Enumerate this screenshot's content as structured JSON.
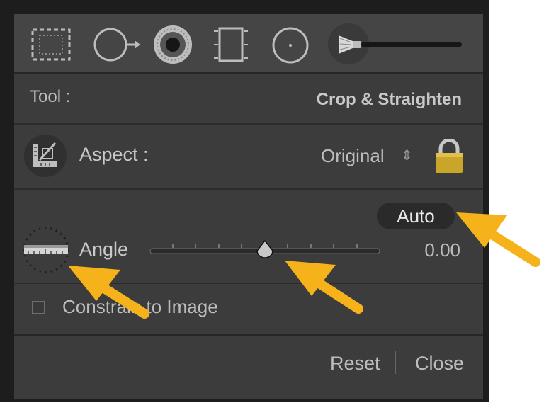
{
  "tools": [
    {
      "name": "Crop Overlay"
    },
    {
      "name": "Spot Removal"
    },
    {
      "name": "Red Eye Correction"
    },
    {
      "name": "Graduated Filter"
    },
    {
      "name": "Radial Filter"
    },
    {
      "name": "Adjustment Brush"
    }
  ],
  "tool_row": {
    "label": "Tool :",
    "value": "Crop & Straighten"
  },
  "aspect_row": {
    "label": "Aspect :",
    "value": "Original",
    "stepper_glyph": "⇕"
  },
  "angle_row": {
    "label": "Angle",
    "value": "0.00",
    "auto_label": "Auto",
    "slider_fraction": 0.5
  },
  "constrain_row": {
    "label": "Constrain to Image",
    "checked": false
  },
  "footer": {
    "reset_label": "Reset",
    "close_label": "Close"
  },
  "colors": {
    "panel": "#3c3c3c",
    "frame": "#1d1d1d",
    "lock": "#c9a52a",
    "annotation_arrow": "#f5b21a"
  }
}
